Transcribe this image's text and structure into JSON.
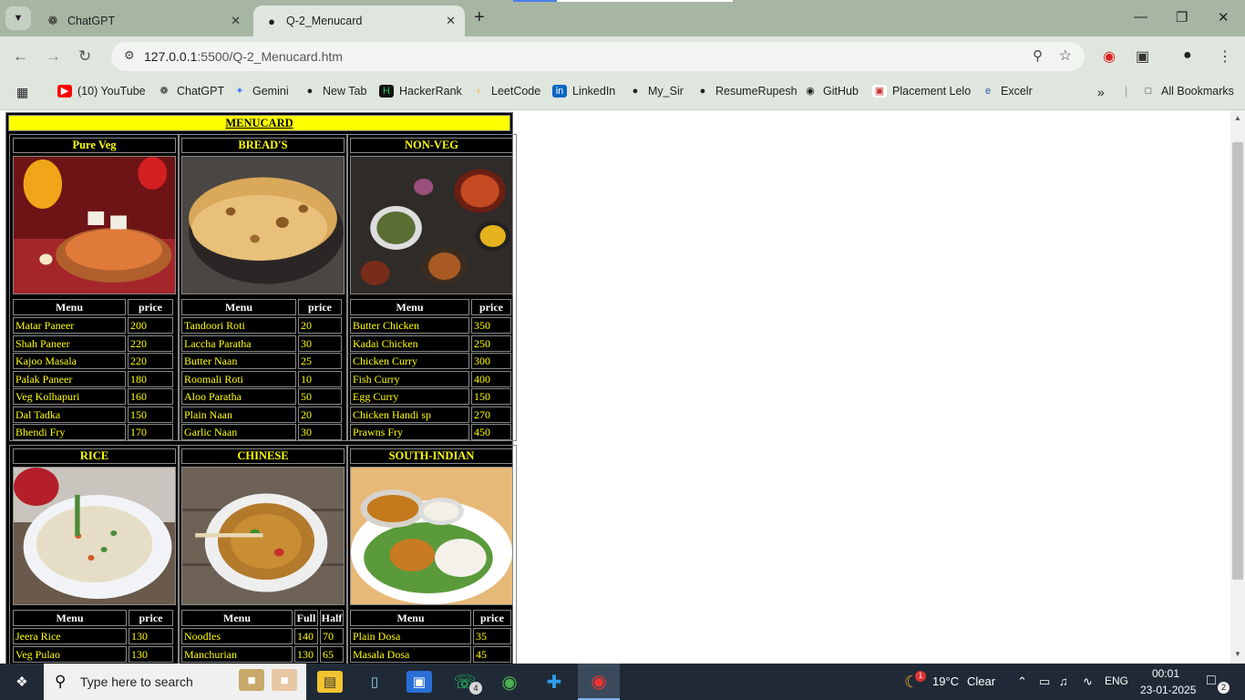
{
  "browser": {
    "tabs": [
      {
        "title": "ChatGPT",
        "icon": "chatgpt-icon"
      },
      {
        "title": "Q-2_Menucard",
        "icon": "globe-icon"
      }
    ],
    "url_host": "127.0.0.1",
    "url_path": ":5500/Q-2_Menucard.htm",
    "bookmarks": [
      {
        "label": "(10) YouTube",
        "icon": "youtube-icon",
        "color": "#ff0000"
      },
      {
        "label": "ChatGPT",
        "icon": "chatgpt-icon",
        "color": "#333333"
      },
      {
        "label": "Gemini",
        "icon": "gemini-icon",
        "color": "#4a7bff"
      },
      {
        "label": "New Tab",
        "icon": "globe-icon",
        "color": "#333333"
      },
      {
        "label": "HackerRank",
        "icon": "hackerrank-icon",
        "color": "#000000"
      },
      {
        "label": "LeetCode",
        "icon": "leetcode-icon",
        "color": "#333333"
      },
      {
        "label": "LinkedIn",
        "icon": "linkedin-icon",
        "color": "#0a66c2"
      },
      {
        "label": "My_Sir",
        "icon": "globe-icon",
        "color": "#333333"
      },
      {
        "label": "ResumeRupesh",
        "icon": "globe-icon",
        "color": "#333333"
      },
      {
        "label": "GitHub",
        "icon": "github-icon",
        "color": "#000000"
      },
      {
        "label": "Placement Lelo",
        "icon": "placement-icon",
        "color": "#cc3333"
      },
      {
        "label": "Excelr",
        "icon": "excelr-icon",
        "color": "#3355aa"
      }
    ],
    "all_bookmarks": "All Bookmarks"
  },
  "menu": {
    "title": "MENUCARD",
    "sections": [
      {
        "name": "Pure Veg",
        "headers": [
          "Menu",
          "price"
        ],
        "widths": [
          124,
          50
        ],
        "rows": [
          [
            "Matar Paneer",
            "200"
          ],
          [
            "Shah Paneer",
            "220"
          ],
          [
            "Kajoo Masala",
            "220"
          ],
          [
            "Palak Paneer",
            "180"
          ],
          [
            "Veg Kolhapuri",
            "160"
          ],
          [
            "Dal Tadka",
            "150"
          ],
          [
            "Bhendi Fry",
            "170"
          ]
        ]
      },
      {
        "name": "BREAD'S",
        "headers": [
          "Menu",
          "price"
        ],
        "widths": [
          126,
          48
        ],
        "rows": [
          [
            "Tandoori Roti",
            "20"
          ],
          [
            "Laccha Paratha",
            "30"
          ],
          [
            "Butter Naan",
            "25"
          ],
          [
            "Roomali Roti",
            "10"
          ],
          [
            "Aloo Paratha",
            "50"
          ],
          [
            "Plain Naan",
            "20"
          ],
          [
            "Garlic Naan",
            "30"
          ]
        ]
      },
      {
        "name": "NON-VEG",
        "headers": [
          "Menu",
          "price"
        ],
        "widths": [
          131,
          44
        ],
        "rows": [
          [
            "Butter Chicken",
            "350"
          ],
          [
            "Kadai Chicken",
            "250"
          ],
          [
            "Chicken Curry",
            "300"
          ],
          [
            "Fish Curry",
            "400"
          ],
          [
            "Egg Curry",
            "150"
          ],
          [
            "Chicken Handi sp",
            "270"
          ],
          [
            "Prawns Fry",
            "450"
          ]
        ]
      },
      {
        "name": "RICE",
        "headers": [
          "Menu",
          "price"
        ],
        "widths": [
          125,
          49
        ],
        "rows": [
          [
            "Jeera Rice",
            "130"
          ],
          [
            "Veg Pulao",
            "130"
          ]
        ]
      },
      {
        "name": "CHINESE",
        "headers": [
          "Menu",
          "Full",
          "Half"
        ],
        "widths": [
          122,
          26,
          26
        ],
        "rows": [
          [
            "Noodles",
            "140",
            "70"
          ],
          [
            "Manchurian",
            "130",
            "65"
          ]
        ]
      },
      {
        "name": "SOUTH-INDIAN",
        "headers": [
          "Menu",
          "price"
        ],
        "widths": [
          133,
          42
        ],
        "rows": [
          [
            "Plain Dosa",
            "35"
          ],
          [
            "Masala Dosa",
            "45"
          ]
        ]
      }
    ]
  },
  "taskbar": {
    "search_placeholder": "Type here to search",
    "weather_temp": "19°C",
    "weather_desc": "Clear",
    "language": "ENG",
    "time": "00:01",
    "date": "23-01-2025",
    "whatsapp_badge": "4",
    "notif_badge": "2",
    "weather_badge": "1"
  }
}
